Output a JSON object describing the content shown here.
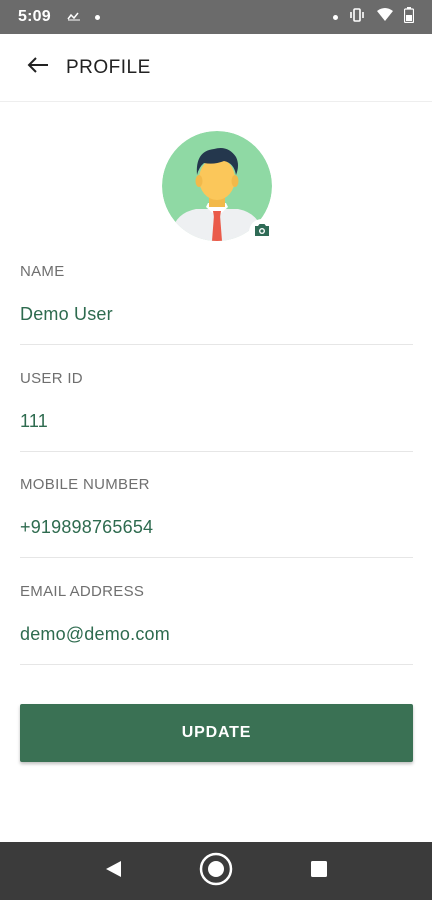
{
  "status_bar": {
    "time": "5:09",
    "left_icons": [
      "signal-strength-icon",
      "notification-dot-icon"
    ],
    "right_icons": [
      "notification-dot-icon",
      "vibrate-icon",
      "wifi-icon",
      "battery-icon"
    ]
  },
  "app_bar": {
    "title": "PROFILE",
    "back_icon": "arrow-left-icon"
  },
  "profile": {
    "avatar_icon": "user-avatar-icon",
    "camera_icon": "camera-icon"
  },
  "fields": [
    {
      "label": "NAME",
      "value": "Demo User"
    },
    {
      "label": "USER ID",
      "value": "111"
    },
    {
      "label": "MOBILE NUMBER",
      "value": "+919898765654"
    },
    {
      "label": "EMAIL ADDRESS",
      "value": "demo@demo.com"
    }
  ],
  "actions": {
    "update_label": "UPDATE"
  },
  "nav_bar": {
    "icons": [
      "back-triangle-icon",
      "home-circle-icon",
      "recents-square-icon"
    ]
  },
  "colors": {
    "accent": "#3a7154",
    "value_text": "#2e6b4f",
    "status_bar": "#6b6b6b",
    "nav_bar": "#3b3b3b"
  }
}
